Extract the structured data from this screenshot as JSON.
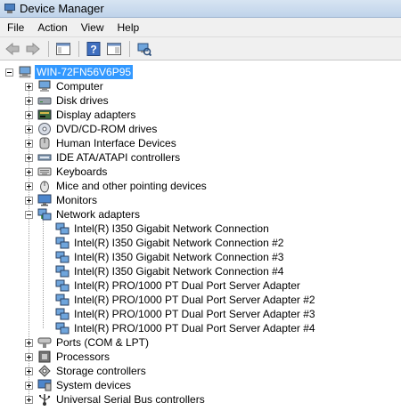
{
  "window": {
    "title": "Device Manager"
  },
  "menu": [
    "File",
    "Action",
    "View",
    "Help"
  ],
  "toolbar": {
    "buttons": [
      "back-icon",
      "forward-icon",
      "show-hide-console-tree-icon",
      "help-icon",
      "properties-icon",
      "scan-hardware-icon"
    ]
  },
  "tree": {
    "root": "WIN-72FN56V6P95",
    "categories": [
      {
        "label": "Computer",
        "icon": "computer-icon",
        "expanded": false
      },
      {
        "label": "Disk drives",
        "icon": "disk-drive-icon",
        "expanded": false
      },
      {
        "label": "Display adapters",
        "icon": "display-adapter-icon",
        "expanded": false
      },
      {
        "label": "DVD/CD-ROM drives",
        "icon": "dvd-drive-icon",
        "expanded": false
      },
      {
        "label": "Human Interface Devices",
        "icon": "hid-icon",
        "expanded": false
      },
      {
        "label": "IDE ATA/ATAPI controllers",
        "icon": "ide-controller-icon",
        "expanded": false
      },
      {
        "label": "Keyboards",
        "icon": "keyboard-icon",
        "expanded": false
      },
      {
        "label": "Mice and other pointing devices",
        "icon": "mouse-icon",
        "expanded": false
      },
      {
        "label": "Monitors",
        "icon": "monitor-icon",
        "expanded": false
      },
      {
        "label": "Network adapters",
        "icon": "network-adapter-icon",
        "expanded": true,
        "children": [
          "Intel(R) I350 Gigabit Network Connection",
          "Intel(R) I350 Gigabit Network Connection #2",
          "Intel(R) I350 Gigabit Network Connection #3",
          "Intel(R) I350 Gigabit Network Connection #4",
          "Intel(R) PRO/1000 PT Dual Port Server Adapter",
          "Intel(R) PRO/1000 PT Dual Port Server Adapter #2",
          "Intel(R) PRO/1000 PT Dual Port Server Adapter #3",
          "Intel(R) PRO/1000 PT Dual Port Server Adapter #4"
        ]
      },
      {
        "label": "Ports (COM & LPT)",
        "icon": "port-icon",
        "expanded": false
      },
      {
        "label": "Processors",
        "icon": "processor-icon",
        "expanded": false
      },
      {
        "label": "Storage controllers",
        "icon": "storage-controller-icon",
        "expanded": false
      },
      {
        "label": "System devices",
        "icon": "system-device-icon",
        "expanded": false
      },
      {
        "label": "Universal Serial Bus controllers",
        "icon": "usb-icon",
        "expanded": false
      }
    ]
  },
  "colors": {
    "selection": "#3399ff",
    "title_bar": "#c9dcf0"
  }
}
